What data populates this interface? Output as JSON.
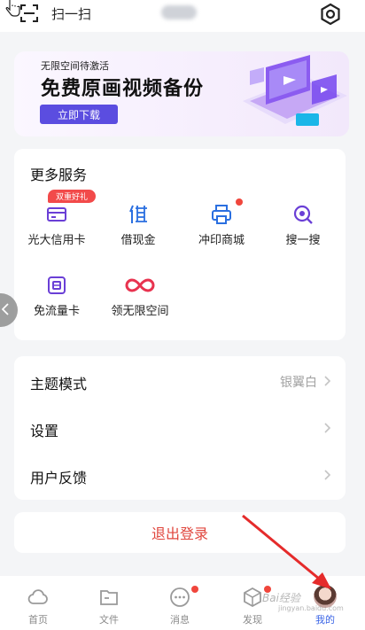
{
  "topbar": {
    "scan_label": "扫一扫"
  },
  "banner": {
    "subtitle": "无限空间待激活",
    "title": "免费原画视频备份",
    "button_label": "立即下载"
  },
  "services": {
    "title": "更多服务",
    "promo_badge": "双重好礼",
    "items": [
      {
        "label": "光大信用卡",
        "icon": "credit-card-icon"
      },
      {
        "label": "借现金",
        "icon": "borrow-icon"
      },
      {
        "label": "冲印商城",
        "icon": "printer-icon"
      },
      {
        "label": "搜一搜",
        "icon": "search-icon"
      },
      {
        "label": "免流量卡",
        "icon": "sim-card-icon"
      },
      {
        "label": "领无限空间",
        "icon": "infinity-icon"
      }
    ]
  },
  "settings": {
    "rows": [
      {
        "label": "主题模式",
        "value": "银翼白"
      },
      {
        "label": "设置",
        "value": ""
      },
      {
        "label": "用户反馈",
        "value": ""
      }
    ]
  },
  "logout_label": "退出登录",
  "bottom_nav": {
    "items": [
      {
        "label": "首页",
        "icon": "cloud-icon"
      },
      {
        "label": "文件",
        "icon": "folder-icon"
      },
      {
        "label": "消息",
        "icon": "message-icon"
      },
      {
        "label": "发现",
        "icon": "cube-icon"
      },
      {
        "label": "我的",
        "icon": "avatar"
      }
    ],
    "active_index": 4
  },
  "watermark": {
    "text": "Bai经验",
    "url": "jingyan.baidu.com"
  },
  "colors": {
    "accent": "#5b4de0",
    "danger": "#e0463d",
    "nav_active": "#3a64e6",
    "badge": "#f24a4a"
  }
}
